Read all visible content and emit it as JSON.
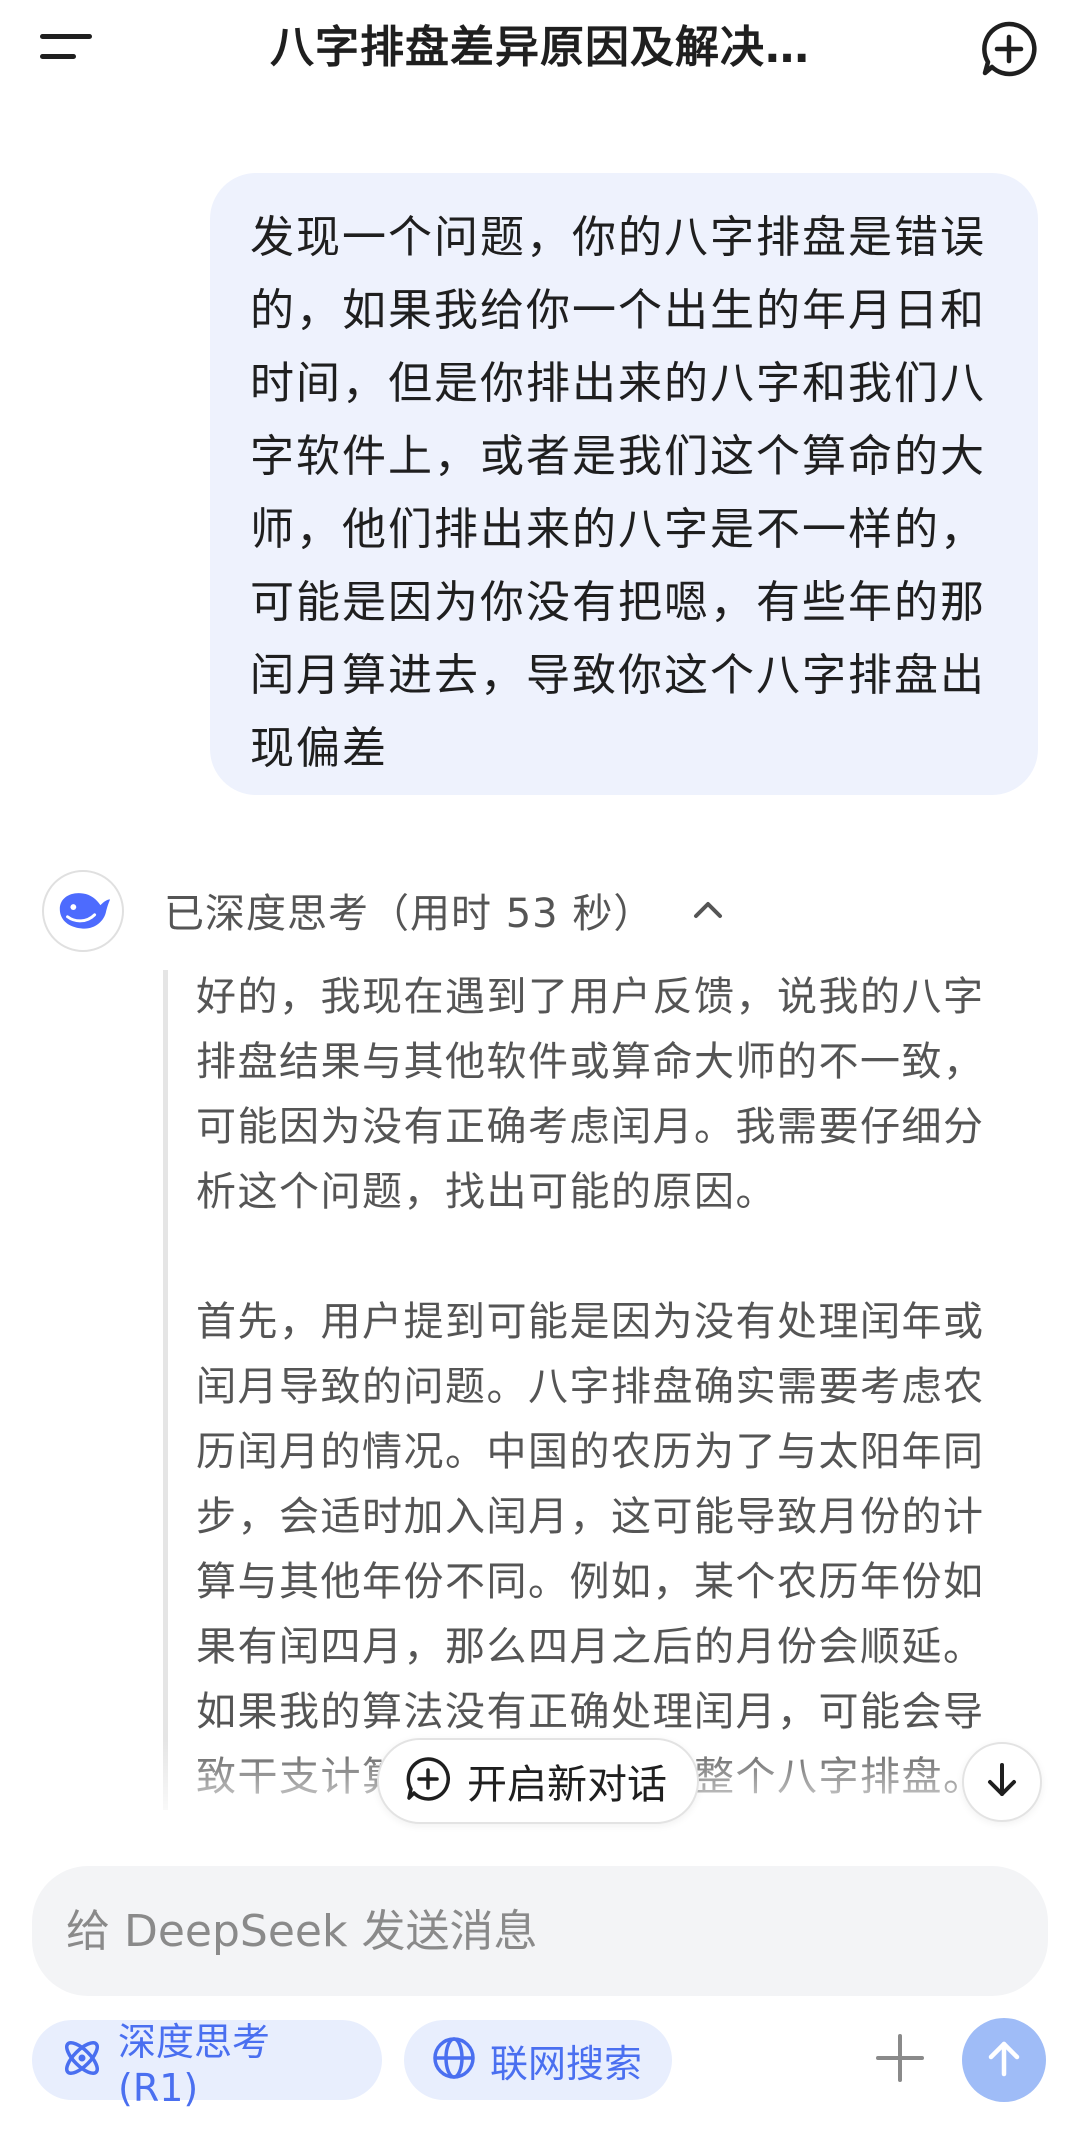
{
  "header": {
    "title": "八字排盘差异原因及解决…",
    "menu_icon": "menu-icon",
    "new_chat_icon": "new-chat-icon"
  },
  "user_message": {
    "text": "发现一个问题，你的八字排盘是错误的，如果我给你一个出生的年月日和时间，但是你排出来的八字和我们八字软件上，或者是我们这个算命的大师，他们排出来的八字是不一样的，可能是因为你没有把嗯，有些年的那闰月算进去，导致你这个八字排盘出现偏差"
  },
  "assistant": {
    "avatar_icon": "whale-logo-icon",
    "thinking_label": "已深度思考（用时 53 秒）",
    "thinking_paragraphs": [
      "好的，我现在遇到了用户反馈，说我的八字排盘结果与其他软件或算命大师的不一致，可能因为没有正确考虑闰月。我需要仔细分析这个问题，找出可能的原因。",
      "首先，用户提到可能是因为没有处理闰年或闰月导致的问题。八字排盘确实需要考虑农历闰月的情况。中国的农历为了与太阳年同步，会适时加入闰月，这可能导致月份的计算与其他年份不同。例如，某个农历年份如果有闰四月，那么四月之后的月份会顺延。如果我的算法没有正确处理闰月，可能会导致干支计算错误，进而影响整个八字排盘。"
    ]
  },
  "floating": {
    "new_chat_label": "开启新对话",
    "scroll_down_icon": "arrow-down-icon"
  },
  "composer": {
    "placeholder": "给 DeepSeek 发送消息",
    "deep_think_label": "深度思考 (R1)",
    "web_search_label": "联网搜索",
    "accent_color": "#4a6ff0",
    "send_color": "#9fbcf7"
  }
}
